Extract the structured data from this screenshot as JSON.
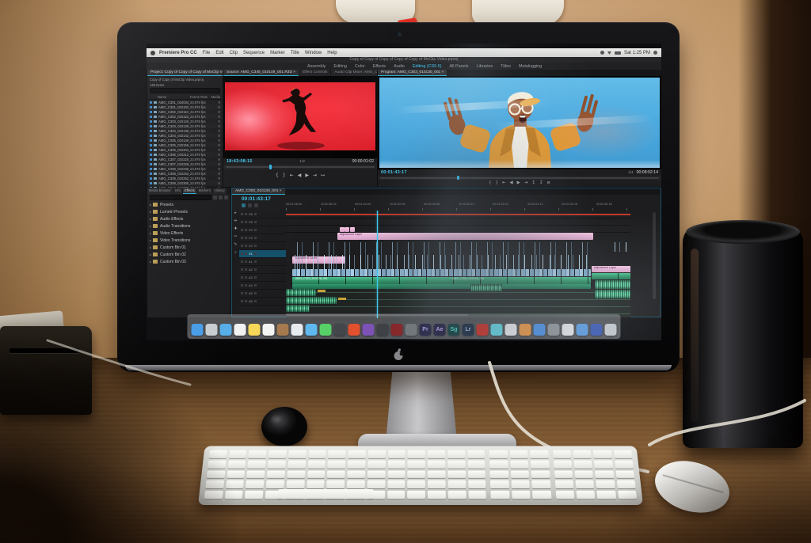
{
  "colors": {
    "accent_cyan": "#2fb4e8",
    "timecode_cyan": "#45c8f0",
    "clip_pink": "#e3aed0",
    "clip_green": "#37a87a"
  },
  "menu_bar": {
    "app_name": "Premiere Pro CC",
    "items": [
      "File",
      "Edit",
      "Clip",
      "Sequence",
      "Marker",
      "Title",
      "Window",
      "Help"
    ],
    "status_time": "Sat 1:25 PM"
  },
  "title_bar": {
    "title": "Copy of Copy of Copy of Copy of Copy of MoClip Video.prproj"
  },
  "workspace_tabs": [
    {
      "label": "Assembly"
    },
    {
      "label": "Editing"
    },
    {
      "label": "Color"
    },
    {
      "label": "Effects"
    },
    {
      "label": "Audio"
    },
    {
      "label": "Editing (CS5.5)",
      "active": true
    },
    {
      "label": "All Panels"
    },
    {
      "label": "Libraries"
    },
    {
      "label": "Titles"
    },
    {
      "label": "Metalogging"
    }
  ],
  "project_panel": {
    "tab_label": "Project: Copy of Copy of Copy of MoClip Video",
    "info_line": "Copy of Copy of MoClip Video.prproj",
    "item_count": "148 Items",
    "columns": {
      "name": "Name",
      "rate": "Frame Rate",
      "media": "Media"
    },
    "rows": [
      {
        "name": "AMG_C301_010034_001",
        "fps": "23.976 fps",
        "media": "V"
      },
      {
        "name": "AMG_C301_010102_001",
        "fps": "23.976 fps",
        "media": "V"
      },
      {
        "name": "AMG_C302_010110_001",
        "fps": "23.976 fps",
        "media": "V"
      },
      {
        "name": "AMG_C302_010118_001",
        "fps": "23.976 fps",
        "media": "V"
      },
      {
        "name": "AMG_C303_010126_001",
        "fps": "23.976 fps",
        "media": "V"
      },
      {
        "name": "AMG_C303_010130_001",
        "fps": "23.976 fps",
        "media": "V"
      },
      {
        "name": "AMG_C304_010138_001",
        "fps": "23.976 fps",
        "media": "V"
      },
      {
        "name": "AMG_C304_010142_001",
        "fps": "23.976 fps",
        "media": "V"
      },
      {
        "name": "AMG_C305_010149_001",
        "fps": "23.976 fps",
        "media": "V"
      },
      {
        "name": "AMG_C305_010156_001",
        "fps": "23.976 fps",
        "media": "V"
      },
      {
        "name": "AMG_C306_010204_001",
        "fps": "23.976 fps",
        "media": "V"
      },
      {
        "name": "AMG_C306_010212_001",
        "fps": "23.976 fps",
        "media": "V"
      },
      {
        "name": "AMG_C307_010220_001",
        "fps": "23.976 fps",
        "media": "V"
      },
      {
        "name": "AMG_C307_010228_001",
        "fps": "23.976 fps",
        "media": "V"
      },
      {
        "name": "AMG_C308_010236_001",
        "fps": "23.976 fps",
        "media": "V"
      },
      {
        "name": "AMG_C308_010244_001",
        "fps": "23.976 fps",
        "media": "V"
      },
      {
        "name": "AMG_C309_010252_001",
        "fps": "23.976 fps",
        "media": "V"
      },
      {
        "name": "AMG_C309_010300_001",
        "fps": "23.976 fps",
        "media": "V"
      },
      {
        "name": "AMG_C310_010308_001",
        "fps": "23.976 fps",
        "media": "V"
      }
    ]
  },
  "source_monitor": {
    "tabs": [
      {
        "label": "Source: AMG_C345_010149_001.R3D ×",
        "active": true
      },
      {
        "label": "Effect Controls"
      },
      {
        "label": "Audio Clip Mixer: AMG_C303_010130_001"
      }
    ],
    "timecode": "18:43:08:15",
    "fit": "1/2",
    "duration": "00:00:01:02",
    "transport": [
      "{",
      "}",
      "⇤",
      "◀",
      "▶",
      "⇥",
      "↦"
    ]
  },
  "program_monitor": {
    "tab_label": "Program: AMG_C303_010130_001 ×",
    "timecode": "00:01:43:17",
    "fit": "1/4",
    "duration": "00:08:02:14",
    "transport": [
      "{",
      "}",
      "⇤",
      "◀",
      "▶",
      "⇥",
      "↥",
      "↧",
      "≡"
    ]
  },
  "effects_panel": {
    "tabs": [
      {
        "label": "Media Browser"
      },
      {
        "label": "Info"
      },
      {
        "label": "Effects",
        "active": true
      },
      {
        "label": "Markers"
      },
      {
        "label": "History"
      }
    ],
    "folders": [
      "Presets",
      "Lumetri Presets",
      "Audio Effects",
      "Audio Transitions",
      "Video Effects",
      "Video Transitions",
      "Custom Bin 01",
      "Custom Bin 02",
      "Custom Bin 03"
    ]
  },
  "timeline": {
    "tab_label": "AMG_C303_010130_001 ×",
    "timecode": "00:01:43:17",
    "ruler": [
      "00:01:28:00",
      "00:01:36:02",
      "00:01:44:04",
      "00:01:52:06",
      "00:02:00:08",
      "00:02:08:10",
      "00:02:16:12",
      "00:02:24:14",
      "00:02:32:16",
      "00:02:40:18"
    ],
    "video_tracks": [
      "V6",
      "V5",
      "V4",
      "V3",
      "V2",
      "V1"
    ],
    "audio_tracks": [
      "A1",
      "A2",
      "A3",
      "A4",
      "A5",
      "A6"
    ],
    "tools": [
      "▸",
      "⇹",
      "✚",
      "✂",
      "✎",
      "⌕"
    ],
    "clips": {
      "adjustment": "Adjustment Layer",
      "pink_left": "Adjustment Layer",
      "pink_right": "Adjustment Layer",
      "green_a": "AMG_C303_010126_001",
      "green_b": "AMG_C304_010138_001"
    }
  },
  "dock": {
    "apps": [
      {
        "name": "finder",
        "bg": "#4a9ee8"
      },
      {
        "name": "launchpad",
        "bg": "#c8cdd2"
      },
      {
        "name": "safari",
        "bg": "#58aee8"
      },
      {
        "name": "photos",
        "bg": "#f2f2f2"
      },
      {
        "name": "notes",
        "bg": "#f6d75a"
      },
      {
        "name": "calendar",
        "bg": "#f4f4f2"
      },
      {
        "name": "contacts",
        "bg": "#a57a4e"
      },
      {
        "name": "reminders",
        "bg": "#e9ecef"
      },
      {
        "name": "messages",
        "bg": "#5fb9ee"
      },
      {
        "name": "facetime",
        "bg": "#57d068"
      },
      {
        "name": "quicktime",
        "bg": "#43474c"
      },
      {
        "name": "ibooks",
        "bg": "#e2502e"
      },
      {
        "name": "imovie",
        "bg": "#7d52b8"
      },
      {
        "name": "photo-booth",
        "bg": "#3c3f44"
      },
      {
        "name": "dvd-player",
        "bg": "#8c1f22"
      },
      {
        "name": "utility",
        "bg": "#74787c"
      },
      {
        "name": "premiere",
        "bg": "#1d1a3e",
        "fg": "#b0a6f0",
        "label": "Pr"
      },
      {
        "name": "after-effects",
        "bg": "#1d1a3e",
        "fg": "#c0a6f0",
        "label": "Ae"
      },
      {
        "name": "speedgrade",
        "bg": "#0c3a3a",
        "fg": "#4ad8cc",
        "label": "Sg"
      },
      {
        "name": "lightroom",
        "bg": "#17263f",
        "fg": "#a9c3ef",
        "label": "Lr"
      },
      {
        "name": "creative-cloud",
        "bg": "#cf2a20"
      },
      {
        "name": "sketch",
        "bg": "#62d8e8"
      },
      {
        "name": "itunes",
        "bg": "#f0f0f2"
      },
      {
        "name": "mail-alt",
        "bg": "#ef9640"
      },
      {
        "name": "app-store",
        "bg": "#4a90e8"
      },
      {
        "name": "camera",
        "bg": "#90949a"
      },
      {
        "name": "documents",
        "bg": "#e4e6e8"
      },
      {
        "name": "folder-blue",
        "bg": "#5a9ae0"
      },
      {
        "name": "folder-dark",
        "bg": "#3a56b0"
      },
      {
        "name": "trash",
        "bg": "#c2c6cc"
      }
    ]
  }
}
